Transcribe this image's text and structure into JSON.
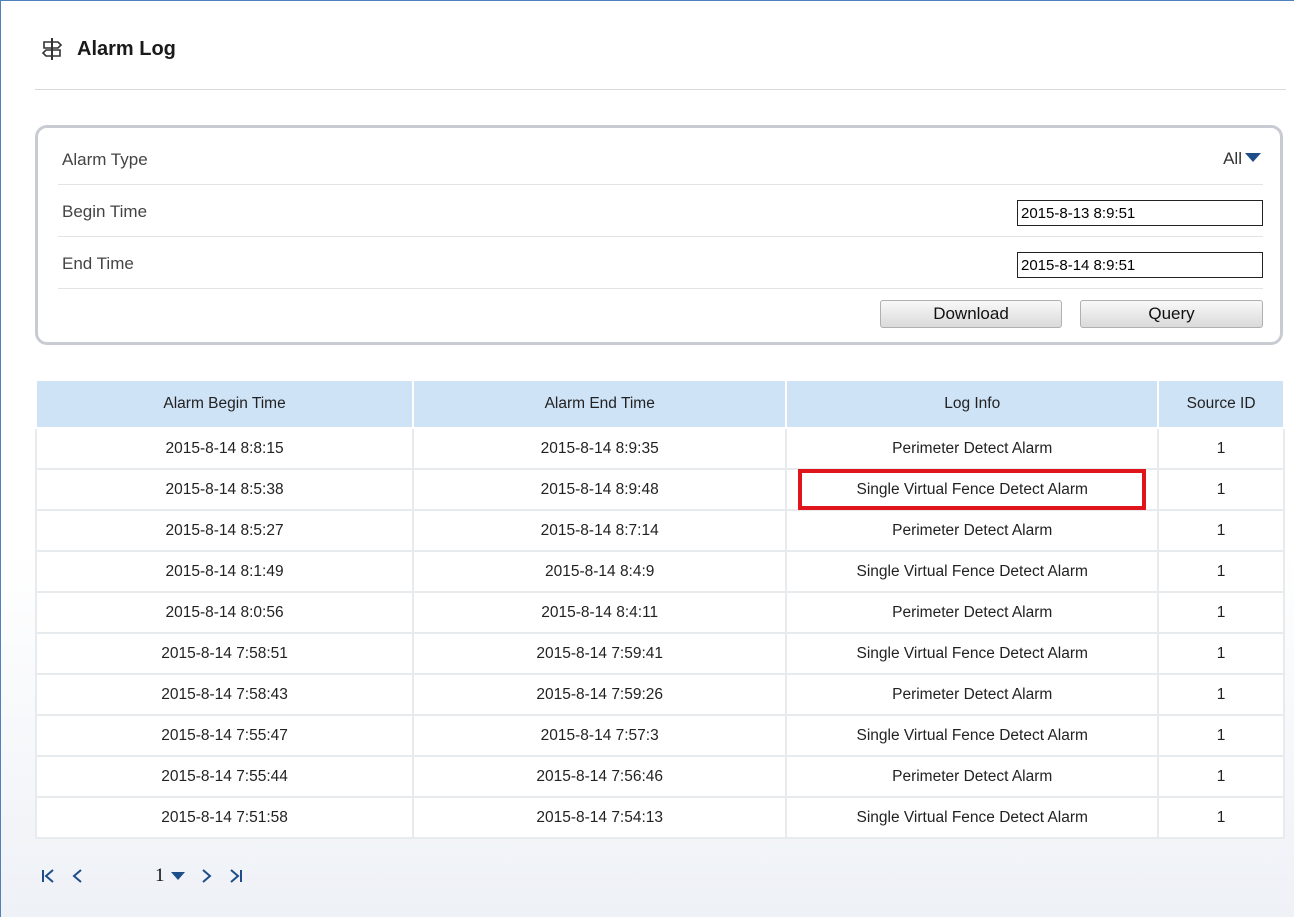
{
  "page": {
    "title": "Alarm Log",
    "title_icon": "signpost-icon"
  },
  "query": {
    "alarm_type_label": "Alarm Type",
    "alarm_type_value": "All",
    "begin_label": "Begin Time",
    "begin_value": "2015-8-13 8:9:51",
    "end_label": "End Time",
    "end_value": "2015-8-14 8:9:51",
    "download_label": "Download",
    "query_label": "Query"
  },
  "table": {
    "headers": [
      "Alarm Begin Time",
      "Alarm End Time",
      "Log Info",
      "Source ID"
    ],
    "rows": [
      [
        "2015-8-14 8:8:15",
        "2015-8-14 8:9:35",
        "Perimeter Detect Alarm",
        "1"
      ],
      [
        "2015-8-14 8:5:38",
        "2015-8-14 8:9:48",
        "Single Virtual Fence Detect Alarm",
        "1"
      ],
      [
        "2015-8-14 8:5:27",
        "2015-8-14 8:7:14",
        "Perimeter Detect Alarm",
        "1"
      ],
      [
        "2015-8-14 8:1:49",
        "2015-8-14 8:4:9",
        "Single Virtual Fence Detect Alarm",
        "1"
      ],
      [
        "2015-8-14 8:0:56",
        "2015-8-14 8:4:11",
        "Perimeter Detect Alarm",
        "1"
      ],
      [
        "2015-8-14 7:58:51",
        "2015-8-14 7:59:41",
        "Single Virtual Fence Detect Alarm",
        "1"
      ],
      [
        "2015-8-14 7:58:43",
        "2015-8-14 7:59:26",
        "Perimeter Detect Alarm",
        "1"
      ],
      [
        "2015-8-14 7:55:47",
        "2015-8-14 7:57:3",
        "Single Virtual Fence Detect Alarm",
        "1"
      ],
      [
        "2015-8-14 7:55:44",
        "2015-8-14 7:56:46",
        "Perimeter Detect Alarm",
        "1"
      ],
      [
        "2015-8-14 7:51:58",
        "2015-8-14 7:54:13",
        "Single Virtual Fence Detect Alarm",
        "1"
      ]
    ]
  },
  "pager": {
    "first": "K",
    "prev": "<",
    "page": "1",
    "next": ">",
    "last": ">|"
  },
  "colors": {
    "header_bg": "#cfe3f7",
    "highlight": "#e0151b",
    "accent": "#1d4e89"
  }
}
